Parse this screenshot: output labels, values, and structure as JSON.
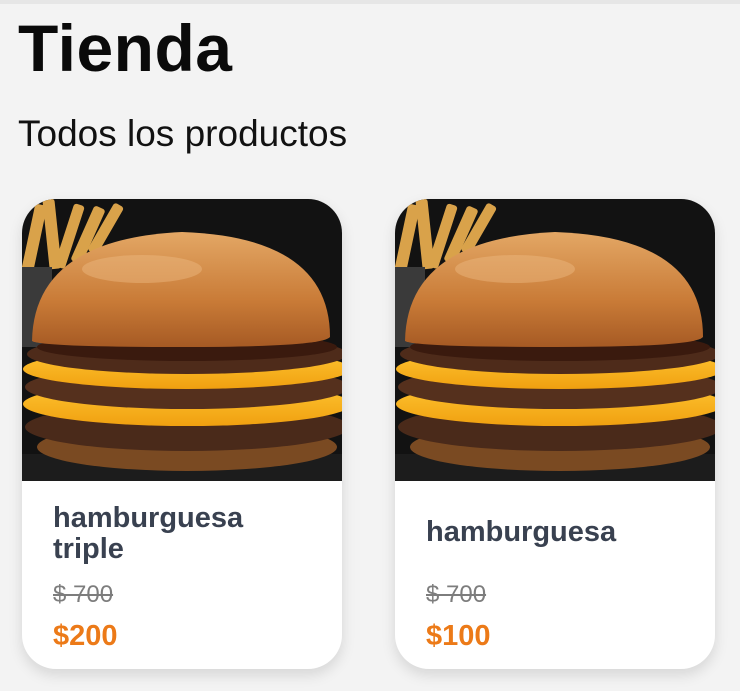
{
  "header": {
    "title": "Tienda",
    "section_title": "Todos los productos"
  },
  "products": [
    {
      "name": "hamburguesa triple",
      "old_price": "$ 700",
      "price": "$200",
      "image": "burger-photo"
    },
    {
      "name": "hamburguesa",
      "old_price": "$ 700",
      "price": "$100",
      "image": "burger-photo"
    }
  ],
  "colors": {
    "background": "#f3f3f3",
    "title": "#0a0a0a",
    "product_name": "#394150",
    "old_price": "#7d7d7d",
    "price": "#ec7a18",
    "card": "#ffffff"
  }
}
